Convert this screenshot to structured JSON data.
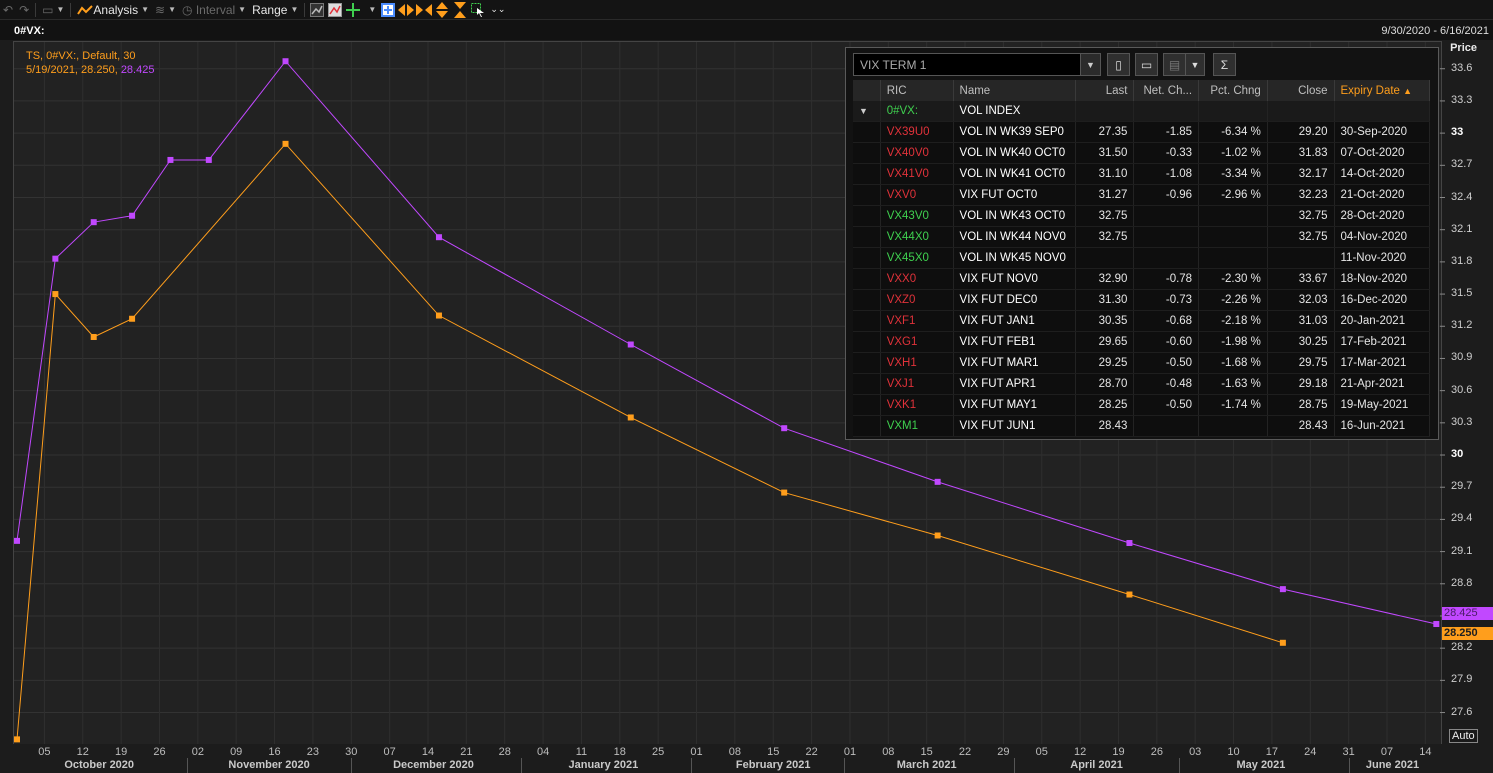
{
  "toolbar": {
    "analysis_label": "Analysis",
    "interval_label": "Interval",
    "range_label": "Range"
  },
  "title": {
    "symbol": "0#VX:",
    "date_range": "9/30/2020 - 6/16/2021"
  },
  "legend": {
    "line1": "TS, 0#VX:, Default,  30",
    "date": "5/19/2021, 28.250, ",
    "value2": "28.425"
  },
  "yaxis": {
    "title": "Price",
    "ticks": [
      "33.6",
      "33.3",
      "33",
      "32.7",
      "32.4",
      "32.1",
      "31.8",
      "31.5",
      "31.2",
      "30.9",
      "30.6",
      "30.3",
      "30",
      "29.7",
      "29.4",
      "29.1",
      "28.8",
      "28.5",
      "28.2",
      "27.9",
      "27.6"
    ],
    "min": 27.4,
    "max": 33.7,
    "auto_label": "Auto"
  },
  "xaxis": {
    "days": [
      {
        "label": "05",
        "d": 5
      },
      {
        "label": "12",
        "d": 12
      },
      {
        "label": "19",
        "d": 19
      },
      {
        "label": "26",
        "d": 26
      },
      {
        "label": "02",
        "d": 33
      },
      {
        "label": "09",
        "d": 40
      },
      {
        "label": "16",
        "d": 47
      },
      {
        "label": "23",
        "d": 54
      },
      {
        "label": "30",
        "d": 61
      },
      {
        "label": "07",
        "d": 68
      },
      {
        "label": "14",
        "d": 75
      },
      {
        "label": "21",
        "d": 82
      },
      {
        "label": "28",
        "d": 89
      },
      {
        "label": "04",
        "d": 96
      },
      {
        "label": "11",
        "d": 103
      },
      {
        "label": "18",
        "d": 110
      },
      {
        "label": "25",
        "d": 117
      },
      {
        "label": "01",
        "d": 124
      },
      {
        "label": "08",
        "d": 131
      },
      {
        "label": "15",
        "d": 138
      },
      {
        "label": "22",
        "d": 145
      },
      {
        "label": "01",
        "d": 152
      },
      {
        "label": "08",
        "d": 159
      },
      {
        "label": "15",
        "d": 166
      },
      {
        "label": "22",
        "d": 173
      },
      {
        "label": "29",
        "d": 180
      },
      {
        "label": "05",
        "d": 187
      },
      {
        "label": "12",
        "d": 194
      },
      {
        "label": "19",
        "d": 201
      },
      {
        "label": "26",
        "d": 208
      },
      {
        "label": "03",
        "d": 215
      },
      {
        "label": "10",
        "d": 222
      },
      {
        "label": "17",
        "d": 229
      },
      {
        "label": "24",
        "d": 236
      },
      {
        "label": "31",
        "d": 243
      },
      {
        "label": "07",
        "d": 250
      },
      {
        "label": "14",
        "d": 257
      }
    ],
    "months": [
      {
        "label": "October 2020",
        "d": 15
      },
      {
        "label": "November 2020",
        "d": 46
      },
      {
        "label": "December 2020",
        "d": 76
      },
      {
        "label": "January 2021",
        "d": 107
      },
      {
        "label": "February 2021",
        "d": 138
      },
      {
        "label": "March 2021",
        "d": 166
      },
      {
        "label": "April 2021",
        "d": 197
      },
      {
        "label": "May 2021",
        "d": 227
      },
      {
        "label": "June 2021",
        "d": 251
      }
    ],
    "month_starts": [
      31,
      61,
      92,
      123,
      151,
      182,
      212,
      243
    ]
  },
  "chart_data": {
    "type": "line",
    "title": "",
    "xlabel": "",
    "ylabel": "Price",
    "ylim": [
      27.4,
      33.7
    ],
    "xlim": [
      "2020-09-30",
      "2021-06-16"
    ],
    "series": [
      {
        "color": "#c148ff",
        "points": [
          {
            "date": "2020-09-30",
            "y": 29.2
          },
          {
            "date": "2020-10-07",
            "y": 31.83
          },
          {
            "date": "2020-10-14",
            "y": 32.17
          },
          {
            "date": "2020-10-21",
            "y": 32.23
          },
          {
            "date": "2020-10-28",
            "y": 32.75
          },
          {
            "date": "2020-11-04",
            "y": 32.75
          },
          {
            "date": "2020-11-18",
            "y": 33.67
          },
          {
            "date": "2020-12-16",
            "y": 32.03
          },
          {
            "date": "2021-01-20",
            "y": 31.03
          },
          {
            "date": "2021-02-17",
            "y": 30.25
          },
          {
            "date": "2021-03-17",
            "y": 29.75
          },
          {
            "date": "2021-04-21",
            "y": 29.18
          },
          {
            "date": "2021-05-19",
            "y": 28.75
          },
          {
            "date": "2021-06-16",
            "y": 28.425
          }
        ]
      },
      {
        "color": "#ff9e1c",
        "points": [
          {
            "date": "2020-09-30",
            "y": 27.35
          },
          {
            "date": "2020-10-07",
            "y": 31.5
          },
          {
            "date": "2020-10-14",
            "y": 31.1
          },
          {
            "date": "2020-10-21",
            "y": 31.27
          },
          {
            "date": "2020-11-18",
            "y": 32.9
          },
          {
            "date": "2020-12-16",
            "y": 31.3
          },
          {
            "date": "2021-01-20",
            "y": 30.35
          },
          {
            "date": "2021-02-17",
            "y": 29.65
          },
          {
            "date": "2021-03-17",
            "y": 29.25
          },
          {
            "date": "2021-04-21",
            "y": 28.7
          },
          {
            "date": "2021-05-19",
            "y": 28.25
          }
        ]
      }
    ]
  },
  "last_tags": {
    "purple": "28.425",
    "orange": "28.250"
  },
  "quote": {
    "chain_name": "VIX TERM 1",
    "columns": [
      "RIC",
      "Name",
      "Last",
      "Net. Ch...",
      "Pct. Chng",
      "Close",
      "Expiry Date"
    ],
    "parent": {
      "ric": "0#VX:",
      "name": "VOL INDEX",
      "expand": "▼"
    },
    "rows": [
      {
        "ric": "VX39U0",
        "name": "VOL IN WK39 SEP0",
        "last": "27.35",
        "net": "-1.85",
        "pct": "-6.34 %",
        "close": "29.20",
        "expiry": "30-Sep-2020",
        "color": "red"
      },
      {
        "ric": "VX40V0",
        "name": "VOL IN WK40 OCT0",
        "last": "31.50",
        "net": "-0.33",
        "pct": "-1.02 %",
        "close": "31.83",
        "expiry": "07-Oct-2020",
        "color": "red"
      },
      {
        "ric": "VX41V0",
        "name": "VOL IN WK41 OCT0",
        "last": "31.10",
        "net": "-1.08",
        "pct": "-3.34 %",
        "close": "32.17",
        "expiry": "14-Oct-2020",
        "color": "red"
      },
      {
        "ric": "VXV0",
        "name": "VIX FUT OCT0",
        "last": "31.27",
        "net": "-0.96",
        "pct": "-2.96 %",
        "close": "32.23",
        "expiry": "21-Oct-2020",
        "color": "red"
      },
      {
        "ric": "VX43V0",
        "name": "VOL IN WK43 OCT0",
        "last": "32.75",
        "net": "",
        "pct": "",
        "close": "32.75",
        "expiry": "28-Oct-2020",
        "color": "green"
      },
      {
        "ric": "VX44X0",
        "name": "VOL IN WK44 NOV0",
        "last": "32.75",
        "net": "",
        "pct": "",
        "close": "32.75",
        "expiry": "04-Nov-2020",
        "color": "green"
      },
      {
        "ric": "VX45X0",
        "name": "VOL IN WK45 NOV0",
        "last": "",
        "net": "",
        "pct": "",
        "close": "",
        "expiry": "11-Nov-2020",
        "color": "green"
      },
      {
        "ric": "VXX0",
        "name": "VIX FUT NOV0",
        "last": "32.90",
        "net": "-0.78",
        "pct": "-2.30 %",
        "close": "33.67",
        "expiry": "18-Nov-2020",
        "color": "red"
      },
      {
        "ric": "VXZ0",
        "name": "VIX FUT DEC0",
        "last": "31.30",
        "net": "-0.73",
        "pct": "-2.26 %",
        "close": "32.03",
        "expiry": "16-Dec-2020",
        "color": "red"
      },
      {
        "ric": "VXF1",
        "name": "VIX FUT JAN1",
        "last": "30.35",
        "net": "-0.68",
        "pct": "-2.18 %",
        "close": "31.03",
        "expiry": "20-Jan-2021",
        "color": "red"
      },
      {
        "ric": "VXG1",
        "name": "VIX FUT FEB1",
        "last": "29.65",
        "net": "-0.60",
        "pct": "-1.98 %",
        "close": "30.25",
        "expiry": "17-Feb-2021",
        "color": "red"
      },
      {
        "ric": "VXH1",
        "name": "VIX FUT MAR1",
        "last": "29.25",
        "net": "-0.50",
        "pct": "-1.68 %",
        "close": "29.75",
        "expiry": "17-Mar-2021",
        "color": "red"
      },
      {
        "ric": "VXJ1",
        "name": "VIX FUT APR1",
        "last": "28.70",
        "net": "-0.48",
        "pct": "-1.63 %",
        "close": "29.18",
        "expiry": "21-Apr-2021",
        "color": "red"
      },
      {
        "ric": "VXK1",
        "name": "VIX FUT MAY1",
        "last": "28.25",
        "net": "-0.50",
        "pct": "-1.74 %",
        "close": "28.75",
        "expiry": "19-May-2021",
        "color": "red"
      },
      {
        "ric": "VXM1",
        "name": "VIX FUT JUN1",
        "last": "28.43",
        "net": "",
        "pct": "",
        "close": "28.43",
        "expiry": "16-Jun-2021",
        "color": "green"
      }
    ]
  }
}
